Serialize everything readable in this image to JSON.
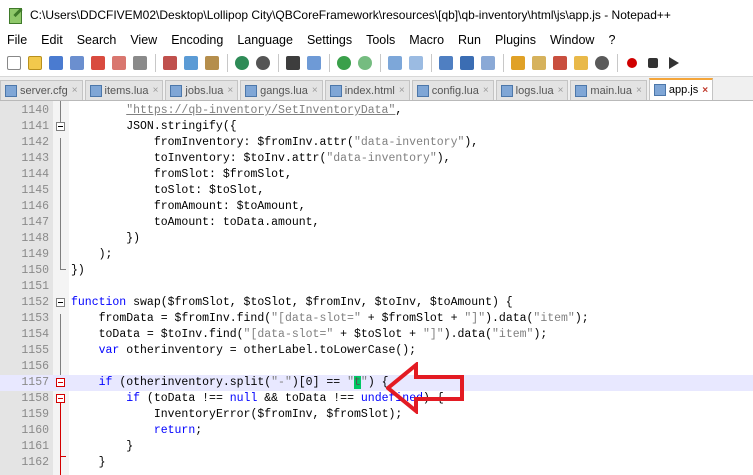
{
  "window": {
    "title": "C:\\Users\\DDCFIVEM02\\Desktop\\Lollipop City\\QBCoreFramework\\resources\\[qb]\\qb-inventory\\html\\js\\app.js - Notepad++"
  },
  "menu": [
    "File",
    "Edit",
    "Search",
    "View",
    "Encoding",
    "Language",
    "Settings",
    "Tools",
    "Macro",
    "Run",
    "Plugins",
    "Window",
    "?"
  ],
  "tabs": [
    {
      "label": "server.cfg",
      "active": false
    },
    {
      "label": "items.lua",
      "active": false
    },
    {
      "label": "jobs.lua",
      "active": false
    },
    {
      "label": "gangs.lua",
      "active": false
    },
    {
      "label": "index.html",
      "active": false
    },
    {
      "label": "config.lua",
      "active": false
    },
    {
      "label": "logs.lua",
      "active": false
    },
    {
      "label": "main.lua",
      "active": false
    },
    {
      "label": "app.js",
      "active": true
    }
  ],
  "tab_close_glyph": "×",
  "editor": {
    "line_numbers": [
      "1140",
      "1141",
      "1142",
      "1143",
      "1144",
      "1145",
      "1146",
      "1147",
      "1148",
      "1149",
      "1150",
      "1151",
      "1152",
      "1153",
      "1154",
      "1155",
      "1156",
      "1157",
      "1158",
      "1159",
      "1160",
      "1161",
      "1162"
    ],
    "lines": {
      "l1140_a": "\"https://qb-inventory/SetInventoryData\"",
      "l1140_b": ",",
      "l1141": "JSON.stringify({",
      "l1142_a": "fromInventory: $fromInv.attr(",
      "l1142_s": "\"data-inventory\"",
      "l1142_b": "),",
      "l1143_a": "toInventory: $toInv.attr(",
      "l1143_s": "\"data-inventory\"",
      "l1143_b": "),",
      "l1144": "fromSlot: $fromSlot,",
      "l1145": "toSlot: $toSlot,",
      "l1146": "fromAmount: $toAmount,",
      "l1147": "toAmount: toData.amount,",
      "l1148": "})",
      "l1149": ");",
      "l1150": "})",
      "l1152_kw": "function",
      "l1152": " swap($fromSlot, $toSlot, $fromInv, $toInv, $toAmount) {",
      "l1153_a": "fromData = $fromInv.find(",
      "l1153_s1": "\"[data-slot=\"",
      "l1153_b": " + $fromSlot + ",
      "l1153_s2": "\"]\"",
      "l1153_c": ").data(",
      "l1153_s3": "\"item\"",
      "l1153_d": ");",
      "l1154_a": "toData = $toInv.find(",
      "l1154_s1": "\"[data-slot=\"",
      "l1154_b": " + $toSlot + ",
      "l1154_s2": "\"]\"",
      "l1154_c": ").data(",
      "l1154_s3": "\"item\"",
      "l1154_d": ");",
      "l1155_kw": "var",
      "l1155": " otherinventory = otherLabel.toLowerCase();",
      "l1157_kw": "if",
      "l1157_a": " (otherinventory.split(",
      "l1157_s1": "\"-\"",
      "l1157_b": ")[0] == ",
      "l1157_q1": "\"",
      "l1157_hl": "t",
      "l1157_q2": "\"",
      "l1157_c": ") {",
      "l1158_kw": "if",
      "l1158_a": " (toData !== ",
      "l1158_kw2": "null",
      "l1158_b": " && toData !== ",
      "l1158_kw3": "undefined",
      "l1158_c": ") {",
      "l1159": "InventoryError($fromInv, $fromSlot);",
      "l1160_kw": "return",
      "l1160": ";",
      "l1161": "}",
      "l1162": "}"
    }
  },
  "colors": {
    "keyword": "#0000ff",
    "string": "#808080",
    "current_line": "#e8e8ff",
    "annotation_arrow": "#e31b23",
    "highlight": "#00c864"
  }
}
